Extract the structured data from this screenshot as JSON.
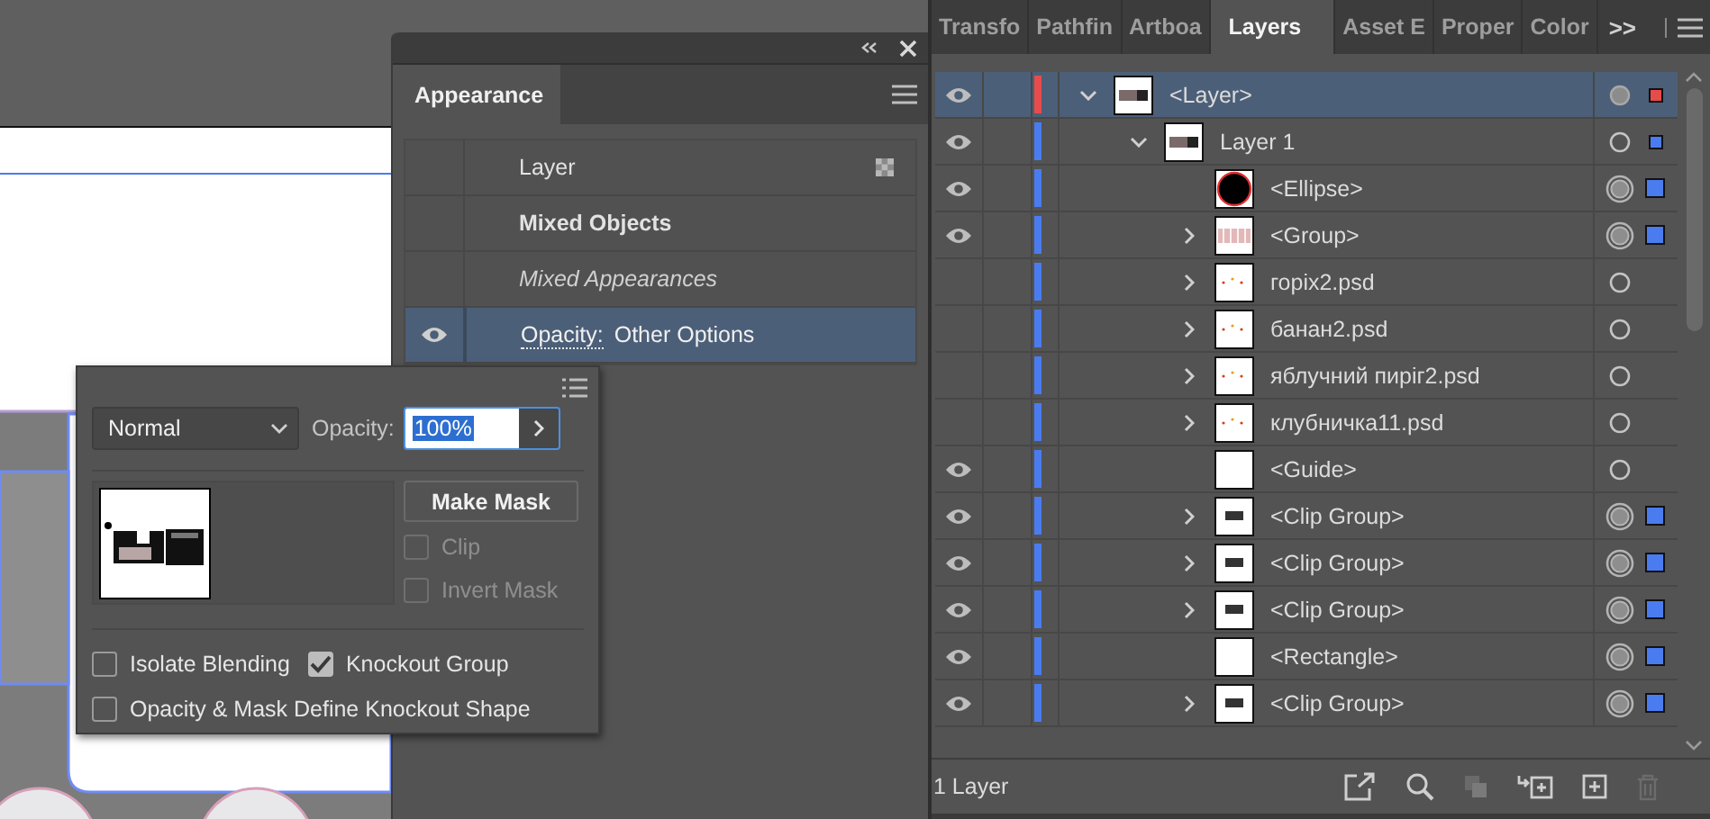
{
  "appearance_panel": {
    "tabs": [
      {
        "label": "Appearance",
        "selected": true
      }
    ],
    "items": [
      {
        "kind": "title",
        "label": "Layer",
        "selected": false
      },
      {
        "kind": "heading",
        "label": "Mixed Objects",
        "selected": false
      },
      {
        "kind": "note",
        "label": "Mixed Appearances",
        "selected": false
      },
      {
        "kind": "attribute",
        "label": "Opacity:",
        "value": "Other Options",
        "visible": true,
        "selected": true
      }
    ]
  },
  "transparency_popup": {
    "blend_mode": "Normal",
    "opacity_label": "Opacity:",
    "opacity_value": "100%",
    "make_mask": "Make Mask",
    "mask_options": [
      {
        "label": "Clip",
        "checked": false,
        "disabled": true
      },
      {
        "label": "Invert Mask",
        "checked": false,
        "disabled": true
      }
    ],
    "knockout_options": [
      {
        "label": "Isolate Blending",
        "checked": false
      },
      {
        "label": "Knockout Group",
        "checked": true
      },
      {
        "label": "Opacity & Mask Define Knockout Shape",
        "checked": false
      }
    ]
  },
  "layers_panel": {
    "tabs": [
      {
        "label": "Transfo",
        "selected": false
      },
      {
        "label": "Pathfin",
        "selected": false
      },
      {
        "label": "Artboa",
        "selected": false
      },
      {
        "label": "Layers",
        "selected": true
      },
      {
        "label": "Asset E",
        "selected": false
      },
      {
        "label": "Proper",
        "selected": false
      },
      {
        "label": "Color",
        "selected": false
      }
    ],
    "overflow": ">>",
    "items": [
      {
        "name": "<Layer>",
        "kind": "layer",
        "visible": true,
        "expanded": true,
        "selected": true,
        "targeted": true,
        "has_appearance": false,
        "art_selected": false,
        "contains_selected": true,
        "color": "#e84b4b",
        "children": [
          {
            "name": "Layer 1",
            "kind": "layer",
            "visible": true,
            "expanded": true,
            "selected": false,
            "targeted": false,
            "has_appearance": false,
            "art_selected": false,
            "contains_selected": true,
            "color": "#4a7cf0",
            "children": [
              {
                "name": "<Ellipse>",
                "kind": "ellipse",
                "visible": true,
                "selected": false,
                "targeted": false,
                "has_appearance": true,
                "art_selected": true,
                "contains_selected": false
              },
              {
                "name": "<Group>",
                "kind": "group",
                "visible": true,
                "expanded": false,
                "selected": false,
                "targeted": false,
                "has_appearance": true,
                "art_selected": true,
                "contains_selected": false
              },
              {
                "name": "горіх2.psd",
                "kind": "image",
                "visible": false,
                "expanded": false,
                "selected": false,
                "targeted": false,
                "has_appearance": false,
                "art_selected": false,
                "contains_selected": false
              },
              {
                "name": "банан2.psd",
                "kind": "image",
                "visible": false,
                "expanded": false,
                "selected": false,
                "targeted": false,
                "has_appearance": false,
                "art_selected": false,
                "contains_selected": false
              },
              {
                "name": "яблучний пиріг2.psd",
                "kind": "image",
                "visible": false,
                "expanded": false,
                "selected": false,
                "targeted": false,
                "has_appearance": false,
                "art_selected": false,
                "contains_selected": false
              },
              {
                "name": "клубничка11.psd",
                "kind": "image",
                "visible": false,
                "expanded": false,
                "selected": false,
                "targeted": false,
                "has_appearance": false,
                "art_selected": false,
                "contains_selected": false
              },
              {
                "name": "<Guide>",
                "kind": "blank",
                "visible": true,
                "selected": false,
                "targeted": false,
                "has_appearance": false,
                "art_selected": false,
                "contains_selected": false
              },
              {
                "name": "<Clip Group>",
                "kind": "clip",
                "visible": true,
                "expanded": false,
                "selected": false,
                "targeted": false,
                "has_appearance": true,
                "art_selected": true,
                "contains_selected": false
              },
              {
                "name": "<Clip Group>",
                "kind": "clip",
                "visible": true,
                "expanded": false,
                "selected": false,
                "targeted": false,
                "has_appearance": true,
                "art_selected": true,
                "contains_selected": false
              },
              {
                "name": "<Clip Group>",
                "kind": "clip",
                "visible": true,
                "expanded": false,
                "selected": false,
                "targeted": false,
                "has_appearance": true,
                "art_selected": true,
                "contains_selected": false
              },
              {
                "name": "<Rectangle>",
                "kind": "blank",
                "visible": true,
                "selected": false,
                "targeted": false,
                "has_appearance": true,
                "art_selected": true,
                "contains_selected": false
              },
              {
                "name": "<Clip Group>",
                "kind": "clip",
                "visible": true,
                "expanded": false,
                "selected": false,
                "targeted": false,
                "has_appearance": true,
                "art_selected": true,
                "contains_selected": false
              }
            ]
          }
        ]
      }
    ],
    "status": "1 Layer"
  }
}
